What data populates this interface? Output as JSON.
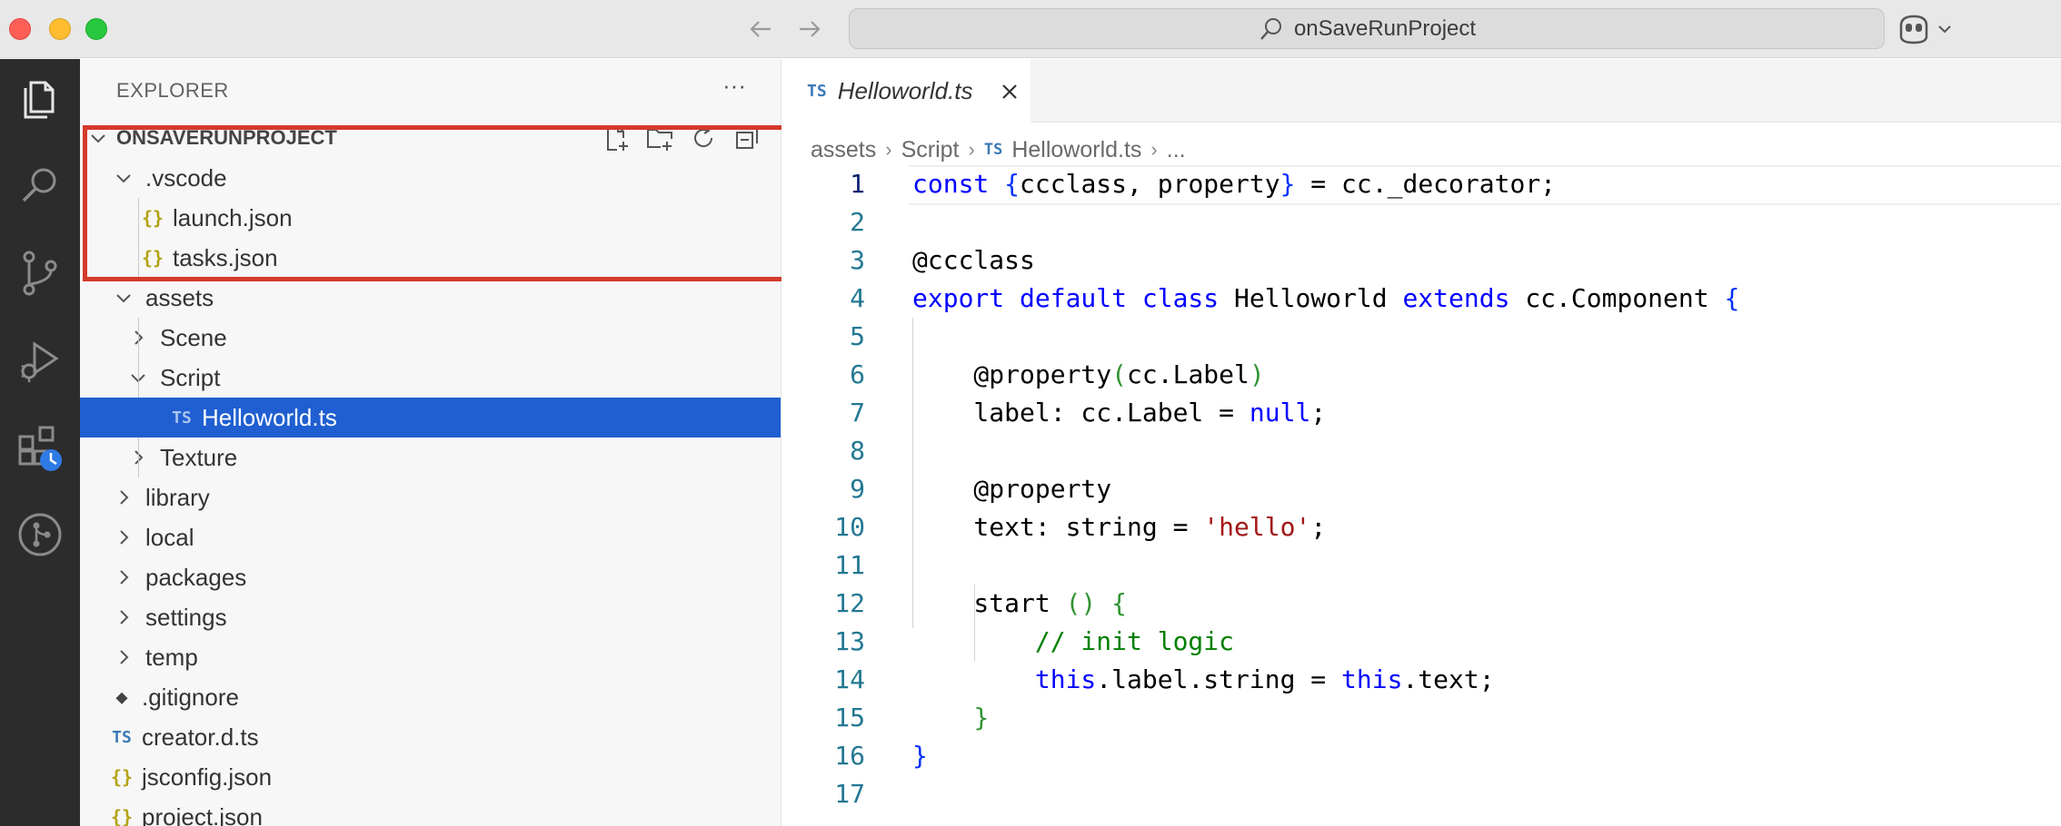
{
  "window": {
    "title": "onSaveRunProject",
    "colors": {
      "red": "#ff5f57",
      "yellow": "#febc2e",
      "green": "#28c840"
    }
  },
  "activity_bar": {
    "items": [
      "explorer-icon",
      "search-icon",
      "source-control-icon",
      "run-debug-icon",
      "extensions-icon",
      "git-graph-icon"
    ]
  },
  "explorer": {
    "title": "EXPLORER",
    "more": "···",
    "root": "ONSAVERUNPROJECT",
    "tree": [
      {
        "label": ".vscode",
        "kind": "folder",
        "open": true
      },
      {
        "label": "launch.json",
        "kind": "json",
        "icon": "{}"
      },
      {
        "label": "tasks.json",
        "kind": "json",
        "icon": "{}"
      },
      {
        "label": "assets",
        "kind": "folder",
        "open": true
      },
      {
        "label": "Scene",
        "kind": "folder",
        "open": false
      },
      {
        "label": "Script",
        "kind": "folder",
        "open": true
      },
      {
        "label": "Helloworld.ts",
        "kind": "ts",
        "icon": "TS",
        "selected": true
      },
      {
        "label": "Texture",
        "kind": "folder",
        "open": false
      },
      {
        "label": "library",
        "kind": "folder",
        "open": false
      },
      {
        "label": "local",
        "kind": "folder",
        "open": false
      },
      {
        "label": "packages",
        "kind": "folder",
        "open": false
      },
      {
        "label": "settings",
        "kind": "folder",
        "open": false
      },
      {
        "label": "temp",
        "kind": "folder",
        "open": false
      },
      {
        "label": ".gitignore",
        "kind": "git",
        "icon": "◆"
      },
      {
        "label": "creator.d.ts",
        "kind": "ts",
        "icon": "TS"
      },
      {
        "label": "jsconfig.json",
        "kind": "json",
        "icon": "{}"
      },
      {
        "label": "project.json",
        "kind": "json",
        "icon": "{}"
      }
    ],
    "highlight_color": "#d43a2b",
    "selection_color": "#1f5fd1"
  },
  "editor": {
    "tab": {
      "badge": "TS",
      "label": "Helloworld.ts"
    },
    "breadcrumb": {
      "items": [
        "assets",
        "Script",
        "Helloworld.ts",
        "..."
      ],
      "file_badge": "TS"
    },
    "lines": [
      {
        "n": "1",
        "tokens": [
          [
            "kw",
            "const "
          ],
          [
            "b1",
            "{"
          ],
          [
            "",
            "ccclass, property"
          ],
          [
            "b1",
            "}"
          ],
          [
            "",
            " = cc._decorator;"
          ]
        ]
      },
      {
        "n": "2",
        "tokens": []
      },
      {
        "n": "3",
        "tokens": [
          [
            "",
            "@ccclass"
          ]
        ]
      },
      {
        "n": "4",
        "tokens": [
          [
            "kw",
            "export default class "
          ],
          [
            "",
            "Helloworld "
          ],
          [
            "kw",
            "extends "
          ],
          [
            "",
            "cc.Component "
          ],
          [
            "b1",
            "{"
          ]
        ]
      },
      {
        "n": "5",
        "tokens": []
      },
      {
        "n": "6",
        "tokens": [
          [
            "",
            "    @property"
          ],
          [
            "b2",
            "("
          ],
          [
            "",
            "cc.Label"
          ],
          [
            "b2",
            ")"
          ]
        ]
      },
      {
        "n": "7",
        "tokens": [
          [
            "",
            "    label: cc.Label = "
          ],
          [
            "kw",
            "null"
          ],
          [
            "",
            ";"
          ]
        ]
      },
      {
        "n": "8",
        "tokens": []
      },
      {
        "n": "9",
        "tokens": [
          [
            "",
            "    @property"
          ]
        ]
      },
      {
        "n": "10",
        "tokens": [
          [
            "",
            "    text: string = "
          ],
          [
            "str",
            "'hello'"
          ],
          [
            "",
            ";"
          ]
        ]
      },
      {
        "n": "11",
        "tokens": []
      },
      {
        "n": "12",
        "tokens": [
          [
            "",
            "    start "
          ],
          [
            "b2",
            "()"
          ],
          [
            "",
            " "
          ],
          [
            "b2",
            "{"
          ]
        ]
      },
      {
        "n": "13",
        "tokens": [
          [
            "",
            "        "
          ],
          [
            "cm",
            "// init logic"
          ]
        ]
      },
      {
        "n": "14",
        "tokens": [
          [
            "",
            "        "
          ],
          [
            "kw",
            "this"
          ],
          [
            "",
            ".label.string = "
          ],
          [
            "kw",
            "this"
          ],
          [
            "",
            ".text;"
          ]
        ]
      },
      {
        "n": "15",
        "tokens": [
          [
            "",
            "    "
          ],
          [
            "b2",
            "}"
          ]
        ]
      },
      {
        "n": "16",
        "tokens": [
          [
            "b1",
            "}"
          ]
        ]
      },
      {
        "n": "17",
        "tokens": []
      }
    ]
  }
}
